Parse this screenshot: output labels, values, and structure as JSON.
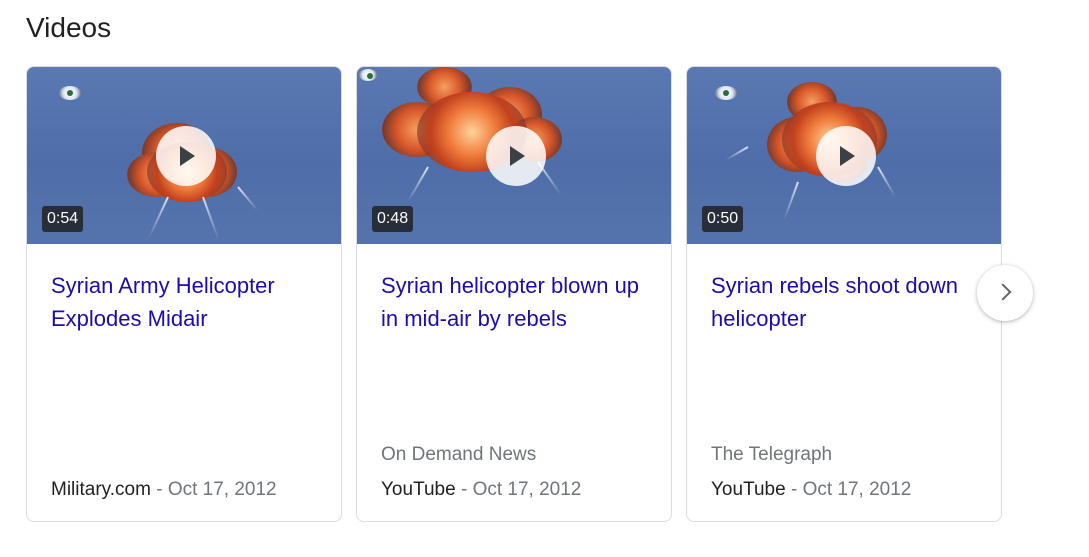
{
  "section": {
    "title": "Videos"
  },
  "videos": [
    {
      "duration": "0:54",
      "title": "Syrian Army Helicopter Explodes Midair",
      "channel": "",
      "source": "Military.com",
      "separator": " - ",
      "date": "Oct 17, 2012"
    },
    {
      "duration": "0:48",
      "title": "Syrian helicopter blown up in mid-air by rebels",
      "channel": "On Demand News",
      "source": "YouTube",
      "separator": " - ",
      "date": "Oct 17, 2012"
    },
    {
      "duration": "0:50",
      "title": "Syrian rebels shoot down helicopter",
      "channel": "The Telegraph",
      "source": "YouTube",
      "separator": " - ",
      "date": "Oct 17, 2012"
    }
  ],
  "icons": {
    "play": "play-icon",
    "next": "chevron-right-icon",
    "watermark": "channel-logo-icon"
  },
  "colors": {
    "link": "#1a0dab",
    "meta": "#70757a",
    "text": "#202124",
    "border": "#dadce0"
  }
}
